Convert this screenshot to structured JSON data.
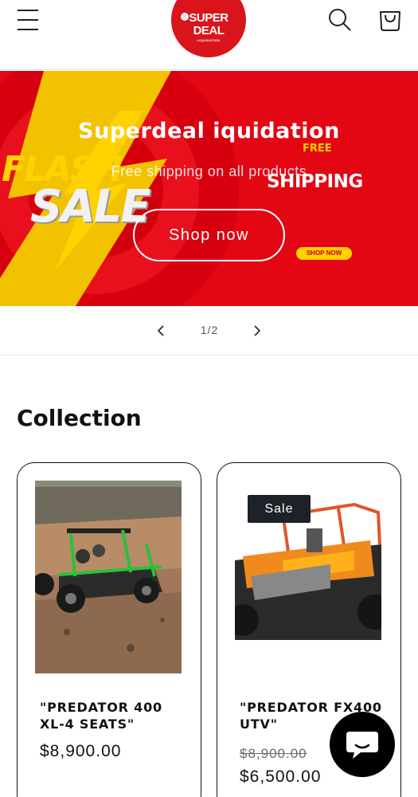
{
  "header": {
    "logo": {
      "line1": "SUPER",
      "line2": "DEAL",
      "line3": "LIQUIDATION"
    },
    "icons": {
      "menu": "menu-icon",
      "search": "search-icon",
      "cart": "cart-icon"
    }
  },
  "banner": {
    "title": "Superdeal iquidation",
    "subtitle": "Free shipping on all products",
    "button_label": "Shop now",
    "art": {
      "flash": "FLASH",
      "sale": "SALE",
      "free": "FREE",
      "shipping": "SHIPPING",
      "shop_now": "SHOP NOW"
    },
    "colors": {
      "background": "#e30613",
      "accent": "#ffd200"
    }
  },
  "slider": {
    "counter": "1/2",
    "icons": {
      "prev": "chevron-left-icon",
      "next": "chevron-right-icon"
    }
  },
  "collection": {
    "title": "Collection",
    "products": [
      {
        "title": "\"PREDATOR 400 XL-4 SEATS\"",
        "price": "$8,900.00"
      },
      {
        "title": "\"PREDATOR FX400 UTV\"",
        "badge": "Sale",
        "compare_price": "$8,900.00",
        "sale_price": "$6,500.00"
      }
    ]
  },
  "chat": {
    "icon": "chat-icon"
  }
}
